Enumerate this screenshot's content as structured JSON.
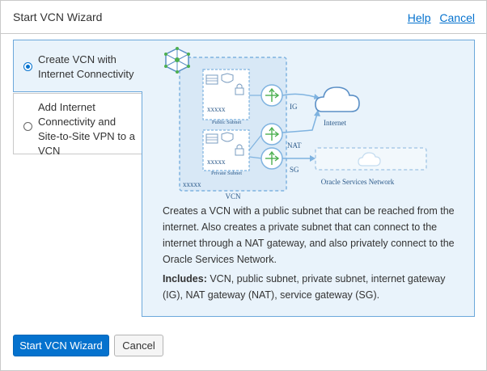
{
  "dialog": {
    "title": "Start VCN Wizard",
    "help_link": "Help",
    "cancel_link": "Cancel"
  },
  "options": [
    {
      "label": "Create VCN with Internet Connectivity",
      "selected": true
    },
    {
      "label": "Add Internet Connectivity and Site-to-Site VPN to a VCN",
      "selected": false
    }
  ],
  "diagram": {
    "public_subnet": "Public Subnet",
    "private_subnet": "Private Subnet",
    "placeholder_public": "xxxxx",
    "placeholder_private": "xxxxx",
    "placeholder_vcn": "xxxxx",
    "vcn": "VCN",
    "ig": "IG",
    "nat": "NAT",
    "sg": "SG",
    "internet": "Internet",
    "oracle_services": "Oracle Services Network"
  },
  "detail": {
    "description": "Creates a VCN with a public subnet that can be reached from the internet. Also creates a private subnet that can connect to the internet through a NAT gateway, and also privately connect to the Oracle Services Network.",
    "includes_label": "Includes:",
    "includes_text": " VCN, public subnet, private subnet, internet gateway (IG), NAT gateway (NAT), service gateway (SG)."
  },
  "footer": {
    "primary_button": "Start VCN Wizard",
    "secondary_button": "Cancel"
  },
  "colors": {
    "accent": "#0572ce",
    "panel_background": "#e9f3fb",
    "panel_border": "#6ca8db",
    "diagram_line": "#7fb3e0",
    "gateway_green": "#4caf50"
  }
}
